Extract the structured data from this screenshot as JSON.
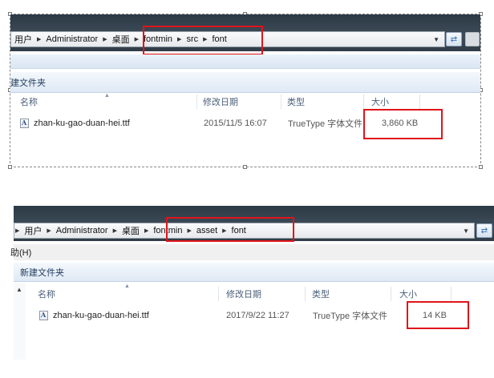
{
  "window1": {
    "breadcrumb": [
      {
        "label": "用户"
      },
      {
        "label": "Administrator"
      },
      {
        "label": "桌面"
      },
      {
        "label": "fontmin"
      },
      {
        "label": "src"
      },
      {
        "label": "font"
      }
    ],
    "new_folder_label": "建文件夹",
    "columns": {
      "name": "名称",
      "modified": "修改日期",
      "type": "类型",
      "size": "大小"
    },
    "file": {
      "name": "zhan-ku-gao-duan-hei.ttf",
      "modified": "2015/11/5 16:07",
      "type": "TrueType 字体文件",
      "size": "3,860 KB"
    }
  },
  "window2": {
    "breadcrumb": [
      {
        "label": "用户"
      },
      {
        "label": "Administrator"
      },
      {
        "label": "桌面"
      },
      {
        "label": "fontmin"
      },
      {
        "label": "asset"
      },
      {
        "label": "font"
      }
    ],
    "menu_help": "助(H)",
    "new_folder_label": "新建文件夹",
    "columns": {
      "name": "名称",
      "modified": "修改日期",
      "type": "类型",
      "size": "大小"
    },
    "file": {
      "name": "zhan-ku-gao-duan-hei.ttf",
      "modified": "2017/9/22 11:27",
      "type": "TrueType 字体文件",
      "size": "14 KB"
    }
  },
  "icons": {
    "breadcrumb_separator": "breadcrumb-arrow-icon",
    "dropdown": "chevron-down-icon",
    "refresh": "refresh-icon",
    "file": "font-file-icon"
  },
  "colors": {
    "highlight_border": "#e0141a",
    "titlebar": "#33414d",
    "commandbar": "#dfe9f5"
  }
}
